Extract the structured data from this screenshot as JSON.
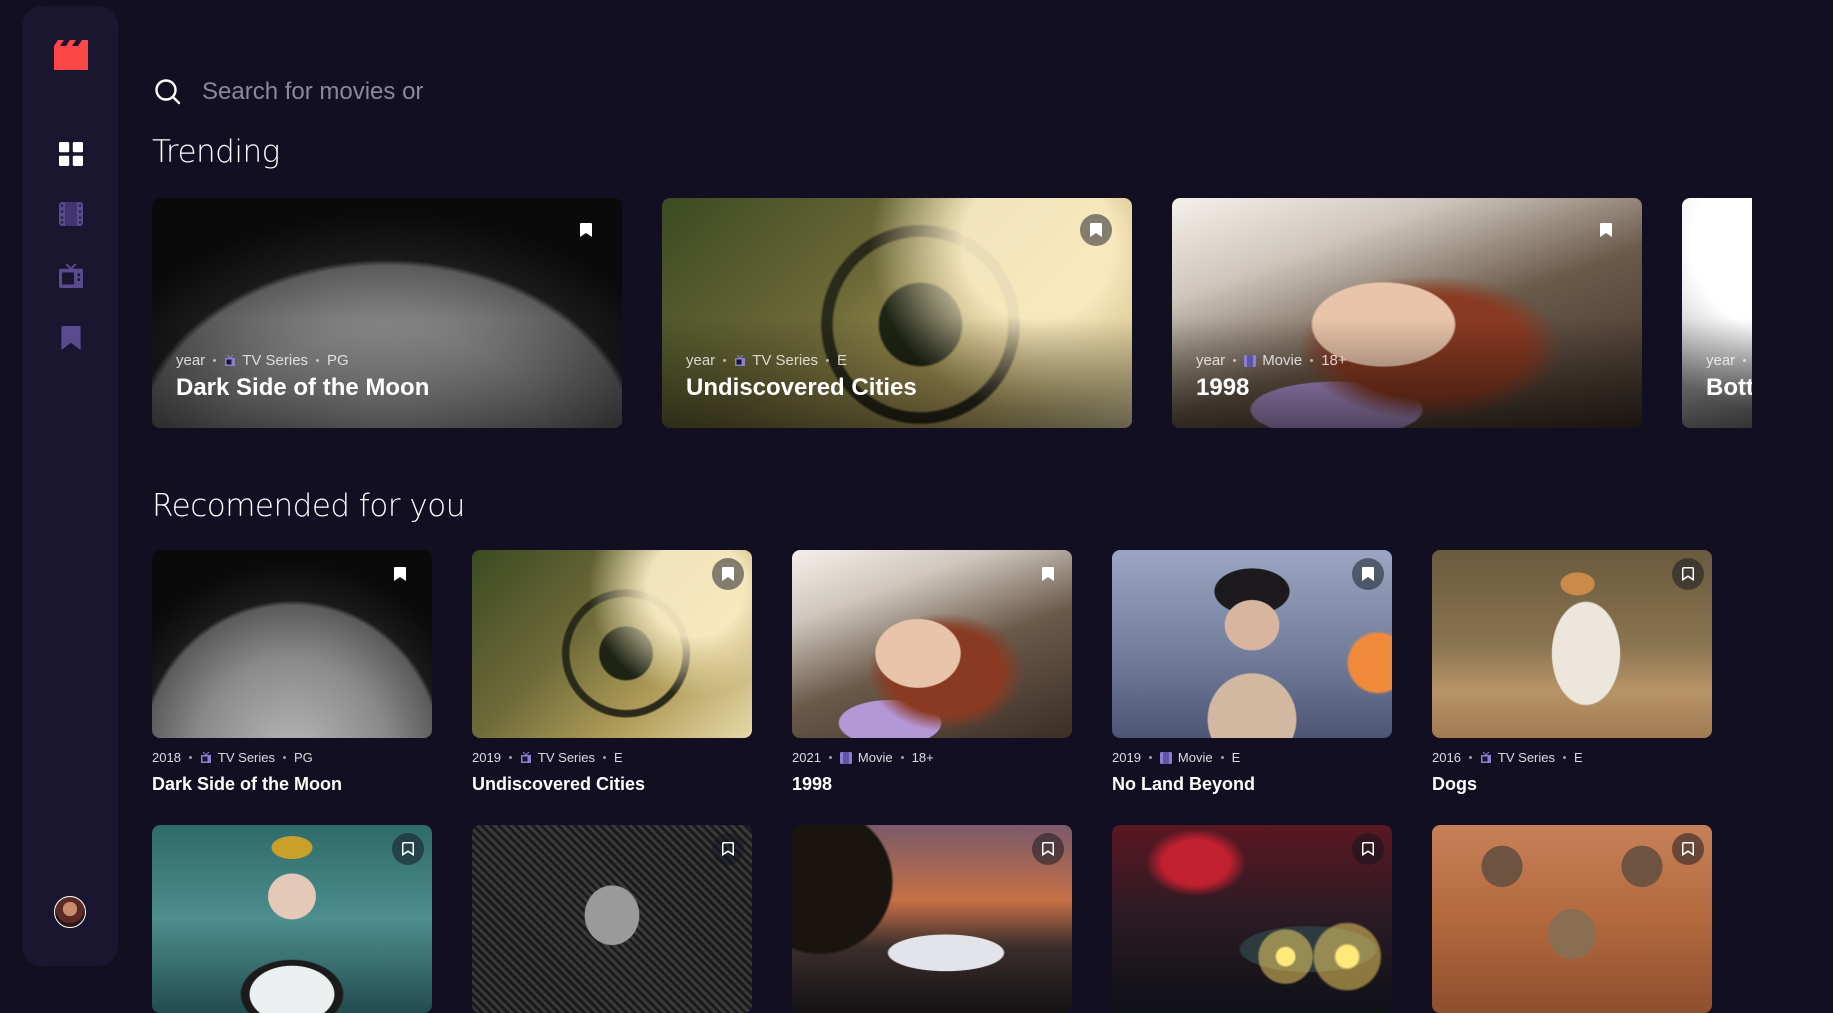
{
  "colors": {
    "background": "#120f22",
    "sidebar": "#1b1630",
    "accent_red": "#FC4747",
    "nav_icon_inactive": "#5A698F",
    "nav_icon_active": "#FFFFFF"
  },
  "sidebar": {
    "logo_icon": "movie-clapper-icon",
    "nav": [
      {
        "name": "home",
        "icon": "grid-icon",
        "active": true
      },
      {
        "name": "movies",
        "icon": "film-icon",
        "active": false
      },
      {
        "name": "tv-series",
        "icon": "tv-icon",
        "active": false
      },
      {
        "name": "bookmarks",
        "icon": "bookmark-icon",
        "active": false
      }
    ],
    "avatar_icon": "user-avatar"
  },
  "search": {
    "placeholder": "Search for movies or",
    "value": ""
  },
  "trending": {
    "heading": "Trending",
    "items": [
      {
        "year": "year",
        "category": "TV Series",
        "rating": "PG",
        "title": "Dark Side of the Moon",
        "bookmarked": true,
        "image": "moon"
      },
      {
        "year": "year",
        "category": "TV Series",
        "rating": "E",
        "title": "Undiscovered Cities",
        "bookmarked": false,
        "image": "car-interior"
      },
      {
        "year": "year",
        "category": "Movie",
        "rating": "18+",
        "title": "1998",
        "bookmarked": true,
        "image": "girl"
      },
      {
        "year": "year",
        "category": "",
        "rating": "",
        "title": "Botto",
        "bookmarked": false,
        "image": "bottom"
      }
    ]
  },
  "recommended": {
    "heading": "Recomended for you",
    "items": [
      {
        "year": "2018",
        "category": "TV Series",
        "rating": "PG",
        "title": "Dark Side of the Moon",
        "bookmarked": true
      },
      {
        "year": "2019",
        "category": "TV Series",
        "rating": "E",
        "title": "Undiscovered Cities",
        "bookmarked": true
      },
      {
        "year": "2021",
        "category": "Movie",
        "rating": "18+",
        "title": "1998",
        "bookmarked": true
      },
      {
        "year": "2019",
        "category": "Movie",
        "rating": "E",
        "title": "No Land Beyond",
        "bookmarked": true
      },
      {
        "year": "2016",
        "category": "TV Series",
        "rating": "E",
        "title": "Dogs",
        "bookmarked": false
      },
      {
        "bookmarked": false
      },
      {
        "bookmarked": false
      },
      {
        "bookmarked": false
      },
      {
        "bookmarked": false
      },
      {
        "bookmarked": false
      }
    ]
  }
}
